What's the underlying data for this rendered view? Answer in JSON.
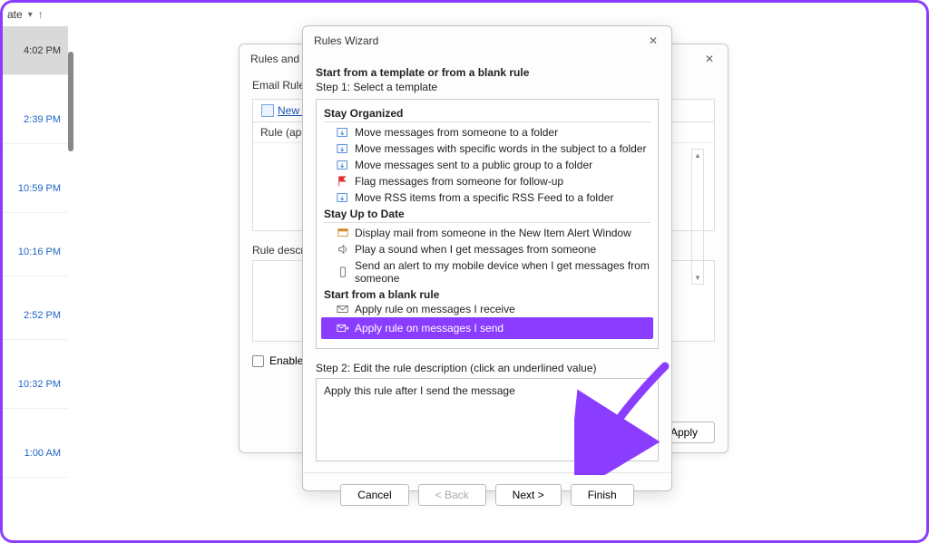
{
  "email_list": {
    "header_label": "ate",
    "items": [
      {
        "time": "4:02 PM",
        "selected": true
      },
      {
        "time": "2:39 PM"
      },
      {
        "time": "10:59 PM"
      },
      {
        "time": "10:16 PM"
      },
      {
        "time": "2:52 PM"
      },
      {
        "time": "10:32 PM"
      },
      {
        "time": "1:00 AM"
      }
    ]
  },
  "rules_alerts": {
    "title": "Rules and Alerts",
    "tab": "Email Rules",
    "new_rule": "New Rule...",
    "header": "Rule (applied in the order shown)",
    "descr_label": "Rule description (click an underlined value to edit):",
    "enable": "Enable rules on all messages downloaded from RSS Feeds",
    "apply": "Apply"
  },
  "wizard": {
    "title": "Rules Wizard",
    "heading": "Start from a template or from a blank rule",
    "step1": "Step 1: Select a template",
    "group_organized": "Stay Organized",
    "org": [
      "Move messages from someone to a folder",
      "Move messages with specific words in the subject to a folder",
      "Move messages sent to a public group to a folder",
      "Flag messages from someone for follow-up",
      "Move RSS items from a specific RSS Feed to a folder"
    ],
    "group_uptodate": "Stay Up to Date",
    "upd": [
      "Display mail from someone in the New Item Alert Window",
      "Play a sound when I get messages from someone",
      "Send an alert to my mobile device when I get messages from someone"
    ],
    "group_blank": "Start from a blank rule",
    "blank": [
      "Apply rule on messages I receive",
      "Apply rule on messages I send"
    ],
    "step2_label": "Step 2: Edit the rule description (click an underlined value)",
    "step2_text": "Apply this rule after I send the message",
    "cancel": "Cancel",
    "back": "< Back",
    "next": "Next >",
    "finish": "Finish"
  }
}
